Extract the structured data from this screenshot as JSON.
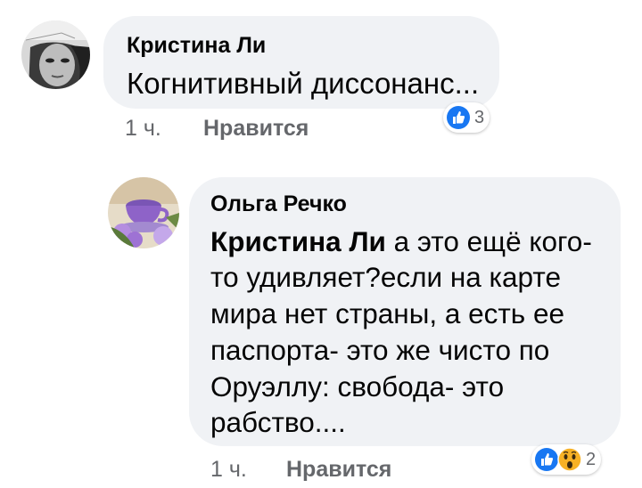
{
  "comments": [
    {
      "author": "Кристина Ли",
      "text": "Когнитивный диссонанс...",
      "time": "1 ч.",
      "like_label": "Нравится",
      "reactions": {
        "icons": [
          "like-icon"
        ],
        "count": "3"
      }
    },
    {
      "author": "Ольга Речко",
      "mention": "Кристина Ли",
      "lines": [
        " а это ещё кого-",
        "то удивляет?если на карте",
        "мира нет страны, а есть  ее",
        "паспорта- это же чисто по",
        "Оруэллу: свобода- это",
        "рабство...."
      ],
      "time": "1 ч.",
      "like_label": "Нравится",
      "reactions": {
        "icons": [
          "like-icon",
          "wow-icon"
        ],
        "count": "2"
      }
    }
  ],
  "colors": {
    "bubble": "#f0f2f5",
    "meta": "#65676b",
    "like_blue": "#1877f2",
    "wow_yellow": "#f7b125"
  }
}
